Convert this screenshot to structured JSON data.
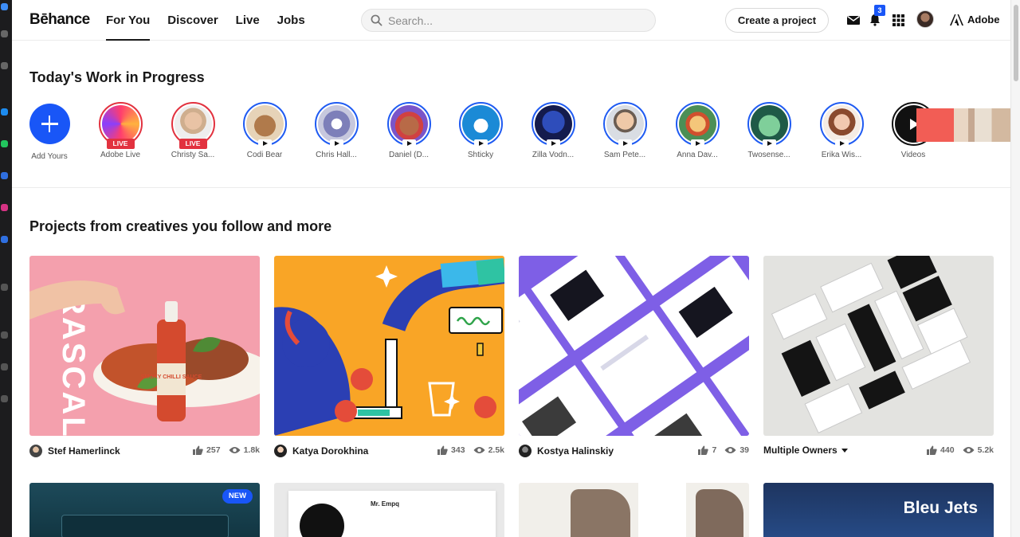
{
  "header": {
    "logo": "Bēhance",
    "nav": [
      "For You",
      "Discover",
      "Live",
      "Jobs"
    ],
    "search_placeholder": "Search...",
    "create_label": "Create a project",
    "notification_count": "3",
    "adobe_label": "Adobe",
    "icons": [
      "search-icon",
      "mail-icon",
      "bell-icon",
      "apps-grid-icon",
      "adobe-logo-icon"
    ]
  },
  "wip": {
    "title": "Today's Work in Progress",
    "live_label": "LIVE",
    "stories": [
      {
        "label": "Add Yours"
      },
      {
        "label": "Adobe Live"
      },
      {
        "label": "Christy Sa..."
      },
      {
        "label": "Codi Bear"
      },
      {
        "label": "Chris Hall..."
      },
      {
        "label": "Daniel (D..."
      },
      {
        "label": "Shticky"
      },
      {
        "label": "Zilla Vodn..."
      },
      {
        "label": "Sam Pete..."
      },
      {
        "label": "Anna Dav..."
      },
      {
        "label": "Twosense..."
      },
      {
        "label": "Erika Wis..."
      },
      {
        "label": "Videos"
      }
    ]
  },
  "projects": {
    "title": "Projects from creatives you follow and more",
    "cards": [
      {
        "owner": "Stef Hamerlinck",
        "likes": "257",
        "views": "1.8k",
        "thumb_text": "RASCAL",
        "label_text": "SMOKY CHILLI SAUCE"
      },
      {
        "owner": "Katya Dorokhina",
        "likes": "343",
        "views": "2.5k"
      },
      {
        "owner": "Kostya Halinskiy",
        "likes": "7",
        "views": "39"
      },
      {
        "owner": "Multiple Owners",
        "likes": "440",
        "views": "5.2k"
      }
    ],
    "row2": [
      {
        "badge": "NEW"
      },
      {
        "text": "Mr. Empq"
      },
      {
        "text": ""
      },
      {
        "text": "Bleu Jets"
      }
    ]
  },
  "colors": {
    "accent": "#1956f7",
    "live": "#e2323f",
    "text": "#191919"
  }
}
